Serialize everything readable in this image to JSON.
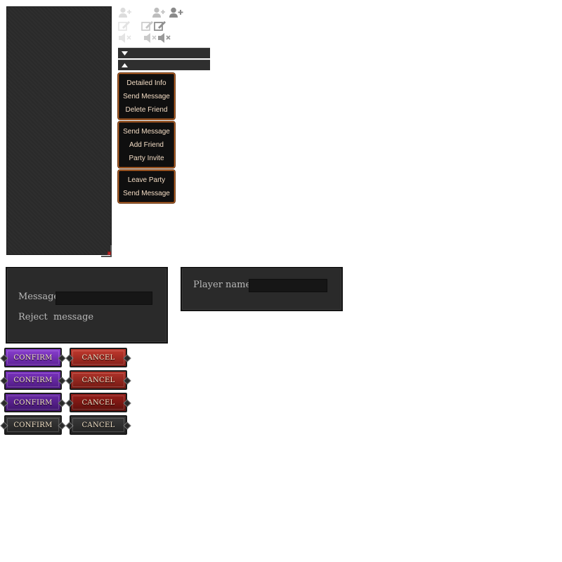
{
  "icons": {
    "add_friend": [
      "add-friend-icon-disabled",
      "add-friend-icon-normal",
      "add-friend-icon-hover"
    ],
    "edit": [
      "edit-icon-disabled",
      "edit-icon-normal",
      "edit-icon-hover"
    ],
    "mute": [
      "mute-icon-disabled",
      "mute-icon-normal",
      "mute-icon-hover"
    ]
  },
  "colors": {
    "panel_bg": "#2b2b2b",
    "menu_border": "#c06a2a",
    "menu_text": "#f3dcc4",
    "confirm_purple": "#7b33c0",
    "cancel_red": "#b2342a"
  },
  "menus": {
    "friend": [
      "Detailed Info",
      "Send Message",
      "Delete Friend"
    ],
    "player": [
      "Send Message",
      "Add Friend",
      "Party Invite"
    ],
    "party": [
      "Leave Party",
      "Send Message"
    ]
  },
  "message_dialog": {
    "message_label": "Message",
    "message_value": "",
    "reject_label": "Reject  message"
  },
  "player_dialog": {
    "player_name_label": "Player name",
    "player_name_value": ""
  },
  "buttons": {
    "confirm": [
      "CONFIRM",
      "CONFIRM",
      "CONFIRM",
      "CONFIRM"
    ],
    "cancel": [
      "CANCEL",
      "CANCEL",
      "CANCEL",
      "CANCEL"
    ]
  }
}
